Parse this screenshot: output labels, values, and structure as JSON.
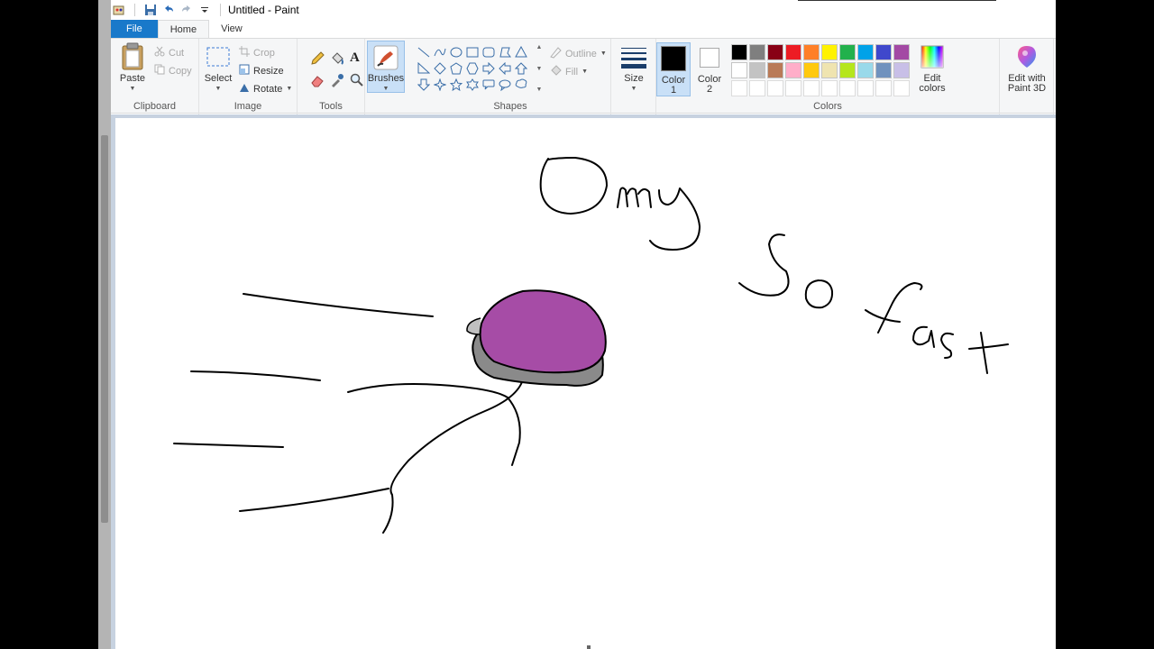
{
  "window": {
    "title": "Untitled - Paint"
  },
  "qat": {
    "icons": [
      "paint-app-icon",
      "save-icon",
      "undo-icon",
      "redo-icon",
      "customize-dropdown-icon"
    ]
  },
  "tabs": [
    {
      "label": "File"
    },
    {
      "label": "Home"
    },
    {
      "label": "View"
    }
  ],
  "ribbon": {
    "clipboard": {
      "label": "Clipboard",
      "paste": "Paste",
      "cut": "Cut",
      "copy": "Copy"
    },
    "image": {
      "label": "Image",
      "select": "Select",
      "crop": "Crop",
      "resize": "Resize",
      "rotate": "Rotate"
    },
    "tools": {
      "label": "Tools"
    },
    "brushes": {
      "label": "Brushes"
    },
    "shapes": {
      "label": "Shapes",
      "outline": "Outline",
      "fill": "Fill"
    },
    "size": {
      "label": "Size"
    },
    "colors": {
      "label": "Colors",
      "color1": "Color",
      "color1_num": "1",
      "color2": "Color",
      "color2_num": "2",
      "edit_colors": "Edit",
      "edit_colors_2": "colors",
      "paint3d": "Edit with",
      "paint3d_2": "Paint 3D",
      "color1_value": "#000000",
      "color2_value": "#ffffff",
      "palette": [
        "#000000",
        "#7f7f7f",
        "#880015",
        "#ed1c24",
        "#ff7f27",
        "#fff200",
        "#22b14c",
        "#00a2e8",
        "#3f48cc",
        "#a349a4",
        "#ffffff",
        "#c3c3c3",
        "#b97a57",
        "#ffaec9",
        "#ffc90e",
        "#efe4b0",
        "#b5e61d",
        "#99d9ea",
        "#7092be",
        "#c8bfe7"
      ]
    }
  },
  "canvas": {
    "text_drawn": [
      "Omy",
      "So fast"
    ],
    "blob_fill": "#a64ca6",
    "blob_shadow": "#8a8a8a"
  }
}
